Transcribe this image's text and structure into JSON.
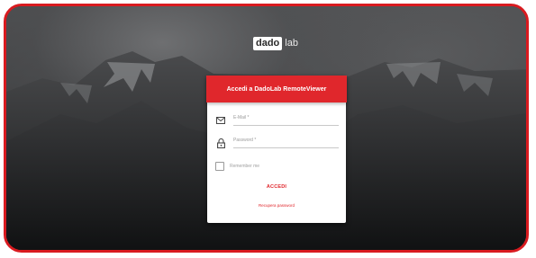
{
  "brand": {
    "box_text": "dado",
    "suffix_text": "lab"
  },
  "login": {
    "title": "Accedi a DadoLab RemoteViewer",
    "email_placeholder": "E-Mail *",
    "password_placeholder": "Password *",
    "remember_label": "Remember me",
    "submit_label": "ACCEDI",
    "recover_label": "Recupera password"
  },
  "colors": {
    "accent": "#e0272c",
    "frame_border": "#d91a1f"
  },
  "icons": {
    "email": "envelope-icon",
    "password": "lock-icon",
    "remember": "checkbox"
  }
}
